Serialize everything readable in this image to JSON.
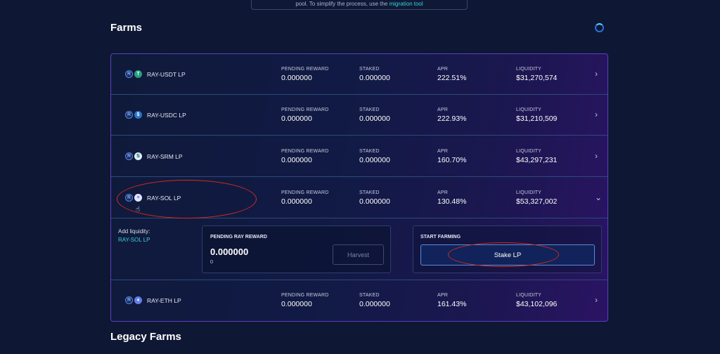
{
  "notice": {
    "text": "pool. To simplify the process, use the",
    "link": "migration tool"
  },
  "farms_title": "Farms",
  "legacy_title": "Legacy Farms",
  "column_labels": {
    "pending": "PENDING REWARD",
    "staked": "STAKED",
    "apr": "APR",
    "liquidity": "LIQUIDITY"
  },
  "farms": [
    {
      "name": "RAY-USDT LP",
      "token_icon": "usdt-icon",
      "token_glyph": "T",
      "pending": "0.000000",
      "staked": "0.000000",
      "apr": "222.51%",
      "liquidity": "$31,270,574",
      "chevron": "›"
    },
    {
      "name": "RAY-USDC LP",
      "token_icon": "usdc-icon",
      "token_glyph": "$",
      "pending": "0.000000",
      "staked": "0.000000",
      "apr": "222.93%",
      "liquidity": "$31,210,509",
      "chevron": "›"
    },
    {
      "name": "RAY-SRM LP",
      "token_icon": "srm-icon",
      "token_glyph": "S",
      "pending": "0.000000",
      "staked": "0.000000",
      "apr": "160.70%",
      "liquidity": "$43,297,231",
      "chevron": "›"
    },
    {
      "name": "RAY-SOL LP",
      "token_icon": "sol-icon",
      "token_glyph": "≡",
      "pending": "0.000000",
      "staked": "0.000000",
      "apr": "130.48%",
      "liquidity": "$53,327,002",
      "chevron": "⌄"
    },
    {
      "name": "RAY-ETH LP",
      "token_icon": "eth-icon",
      "token_glyph": "♦",
      "pending": "0.000000",
      "staked": "0.000000",
      "apr": "161.43%",
      "liquidity": "$43,102,096",
      "chevron": "›"
    }
  ],
  "expanded": {
    "add_liquidity_label": "Add liquidity:",
    "add_liquidity_link": "RAY-SOL LP",
    "pending_title": "PENDING RAY REWARD",
    "pending_amount": "0.000000",
    "pending_sub": "0",
    "harvest_label": "Harvest",
    "start_title": "START FARMING",
    "stake_label": "Stake LP"
  },
  "colors": {
    "background": "#0e1733",
    "accent_teal": "#39d0d8",
    "annotation_red": "#d42a1e",
    "panel_border": "#5b3fc4"
  }
}
